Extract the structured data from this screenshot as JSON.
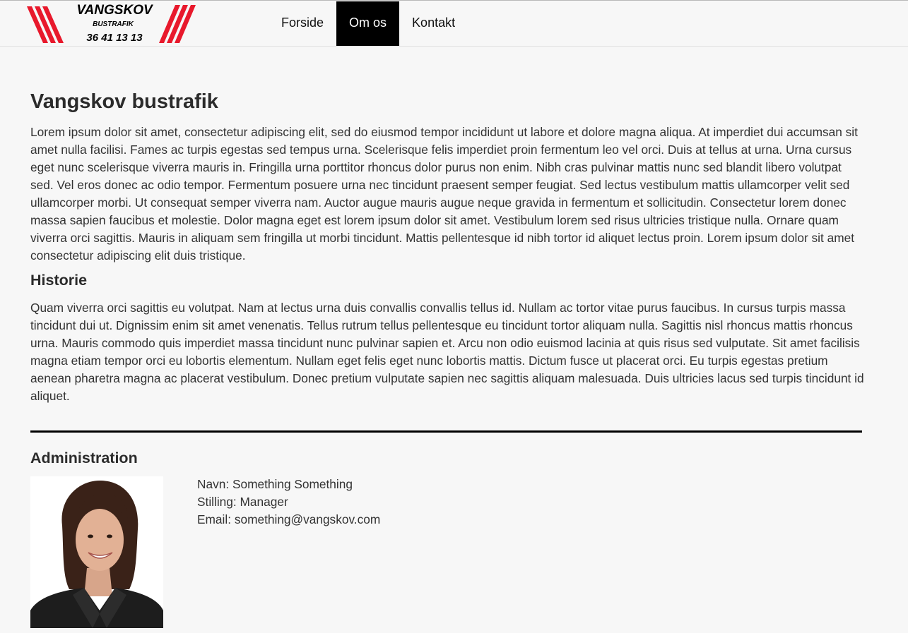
{
  "brand": {
    "logo_name": "VANGSKOV",
    "logo_sub": "BUSTRAFIK",
    "logo_phone": "36 41 13 13",
    "accent_color": "#e8192c"
  },
  "nav": {
    "items": [
      {
        "label": "Forside",
        "active": false
      },
      {
        "label": "Om os",
        "active": true
      },
      {
        "label": "Kontakt",
        "active": false
      }
    ]
  },
  "main": {
    "title": "Vangskov bustrafik",
    "intro": "Lorem ipsum dolor sit amet, consectetur adipiscing elit, sed do eiusmod tempor incididunt ut labore et dolore magna aliqua. At imperdiet dui accumsan sit amet nulla facilisi. Fames ac turpis egestas sed tempus urna. Scelerisque felis imperdiet proin fermentum leo vel orci. Duis at tellus at urna. Urna cursus eget nunc scelerisque viverra mauris in. Fringilla urna porttitor rhoncus dolor purus non enim. Nibh cras pulvinar mattis nunc sed blandit libero volutpat sed. Vel eros donec ac odio tempor. Fermentum posuere urna nec tincidunt praesent semper feugiat. Sed lectus vestibulum mattis ullamcorper velit sed ullamcorper morbi. Ut consequat semper viverra nam. Auctor augue mauris augue neque gravida in fermentum et sollicitudin. Consectetur lorem donec massa sapien faucibus et molestie. Dolor magna eget est lorem ipsum dolor sit amet. Vestibulum lorem sed risus ultricies tristique nulla. Ornare quam viverra orci sagittis. Mauris in aliquam sem fringilla ut morbi tincidunt. Mattis pellentesque id nibh tortor id aliquet lectus proin. Lorem ipsum dolor sit amet consectetur adipiscing elit duis tristique.",
    "history_heading": "Historie",
    "history_text": "Quam viverra orci sagittis eu volutpat. Nam at lectus urna duis convallis convallis tellus id. Nullam ac tortor vitae purus faucibus. In cursus turpis massa tincidunt dui ut. Dignissim enim sit amet venenatis. Tellus rutrum tellus pellentesque eu tincidunt tortor aliquam nulla. Sagittis nisl rhoncus mattis rhoncus urna. Mauris commodo quis imperdiet massa tincidunt nunc pulvinar sapien et. Arcu non odio euismod lacinia at quis risus sed vulputate. Sit amet facilisis magna etiam tempor orci eu lobortis elementum. Nullam eget felis eget nunc lobortis mattis. Dictum fusce ut placerat orci. Eu turpis egestas pretium aenean pharetra magna ac placerat vestibulum. Donec pretium vulputate sapien nec sagittis aliquam malesuada. Duis ultricies lacus sed turpis tincidunt id aliquet.",
    "admin_heading": "Administration",
    "admin": {
      "name_line": "Navn: Something Something",
      "role_line": "Stilling: Manager",
      "email_line": "Email: something@vangskov.com"
    }
  }
}
